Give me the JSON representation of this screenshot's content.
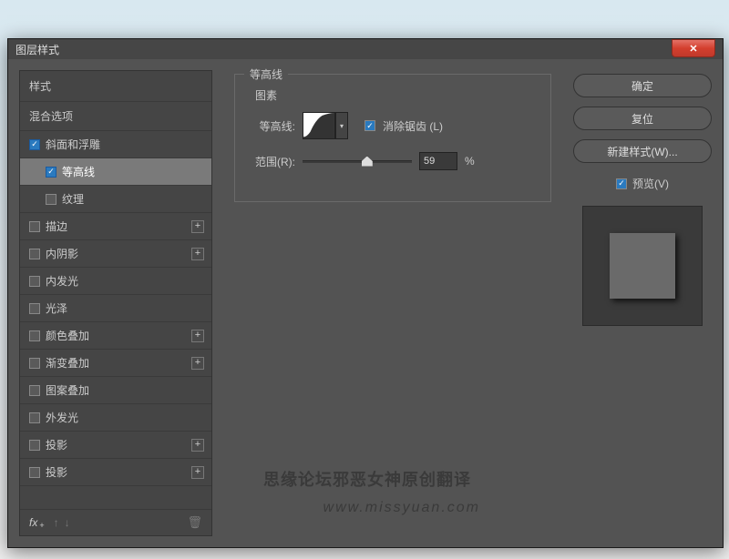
{
  "dialog": {
    "title": "图层样式"
  },
  "styles": {
    "header": "样式",
    "blend": "混合选项",
    "items": [
      {
        "label": "斜面和浮雕",
        "checked": true,
        "indent": false,
        "plus": false
      },
      {
        "label": "等高线",
        "checked": true,
        "indent": true,
        "plus": false,
        "selected": true
      },
      {
        "label": "纹理",
        "checked": false,
        "indent": true,
        "plus": false
      },
      {
        "label": "描边",
        "checked": false,
        "indent": false,
        "plus": true
      },
      {
        "label": "内阴影",
        "checked": false,
        "indent": false,
        "plus": true
      },
      {
        "label": "内发光",
        "checked": false,
        "indent": false,
        "plus": false
      },
      {
        "label": "光泽",
        "checked": false,
        "indent": false,
        "plus": false
      },
      {
        "label": "颜色叠加",
        "checked": false,
        "indent": false,
        "plus": true
      },
      {
        "label": "渐变叠加",
        "checked": false,
        "indent": false,
        "plus": true
      },
      {
        "label": "图案叠加",
        "checked": false,
        "indent": false,
        "plus": false
      },
      {
        "label": "外发光",
        "checked": false,
        "indent": false,
        "plus": false
      },
      {
        "label": "投影",
        "checked": false,
        "indent": false,
        "plus": true
      },
      {
        "label": "投影",
        "checked": false,
        "indent": false,
        "plus": true
      }
    ],
    "fx": "fx"
  },
  "contour": {
    "group_title": "等高线",
    "element_label": "图素",
    "contour_label": "等高线:",
    "antialias": "消除锯齿 (L)",
    "range_label": "范围(R):",
    "range_value": "59",
    "range_unit": "%"
  },
  "right": {
    "ok": "确定",
    "reset": "复位",
    "newstyle": "新建样式(W)...",
    "preview": "预览(V)"
  },
  "watermark": {
    "line1": "思缘论坛邪恶女神原创翻译",
    "line2": "www.missyuan.com"
  }
}
